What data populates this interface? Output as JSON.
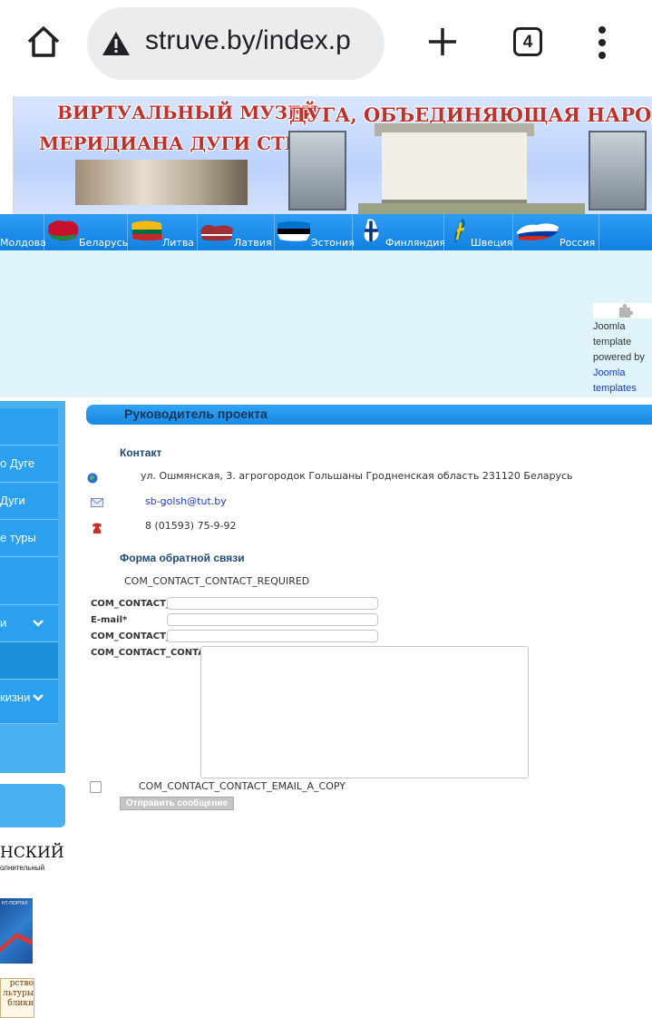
{
  "browser": {
    "url": "struve.by/index.p",
    "tab_count": "4"
  },
  "banner": {
    "title_line1": "ВИРТУАЛЬНЫЙ МУЗЕЙ",
    "title_line2": "МЕРИДИАНА ДУГИ СТРУВЕ",
    "title_right": "ДУГА, ОБЪЕДИНЯЮЩАЯ НАРОДЫ И КУЛЬТУРЫ"
  },
  "nav": {
    "items": [
      {
        "label": "Молдова"
      },
      {
        "label": "Беларусь"
      },
      {
        "label": "Литва"
      },
      {
        "label": "Латвия"
      },
      {
        "label": "Эстония"
      },
      {
        "label": "Финляндия"
      },
      {
        "label": "Швеция"
      },
      {
        "label": "Россия"
      }
    ]
  },
  "joomla": {
    "line1": "Joomla",
    "line2": "template",
    "line3": "powered by",
    "link1": "Joomla",
    "link2": "templates"
  },
  "sidebar": {
    "items": [
      {
        "label": ""
      },
      {
        "label": "о Дуге"
      },
      {
        "label": "Дуги"
      },
      {
        "label": "е туры"
      },
      {
        "label": ""
      },
      {
        "label": "и"
      },
      {
        "label": ""
      },
      {
        "label": "кизни"
      }
    ],
    "rayon": "НСКИЙ",
    "rayon_sub": "олнительный",
    "portal_label": "НТ-ПОРТАЛ",
    "ministry_line1": "рство",
    "ministry_line2": "льтуры",
    "ministry_line3": "блики"
  },
  "content": {
    "page_title": "Руководитель проекта",
    "contact_heading": "Контакт",
    "address": "ул. Ошмянская, 3. агрогородок Гольшаны Гродненская область 231120 Беларусь",
    "email": "sb-golsh@tut.by",
    "phone": "8 (01593) 75-9-92",
    "form_heading": "Форма обратной связи",
    "required_note": "COM_CONTACT_CONTACT_REQUIRED",
    "name_label": "COM_CONTACT_CONTACT_EMAIL_NAME",
    "email_label": "E-mail*",
    "subject_label": "COM_CONTACT_CONTACT_MESSAGE_SUBJECT:",
    "message_label": "COM_CONTACT_CONTACT_ENTER_MESSAGE:",
    "copy_label": "COM_CONTACT_CONTACT_EMAIL_A_COPY",
    "submit_label": "Отправить сообщение"
  }
}
